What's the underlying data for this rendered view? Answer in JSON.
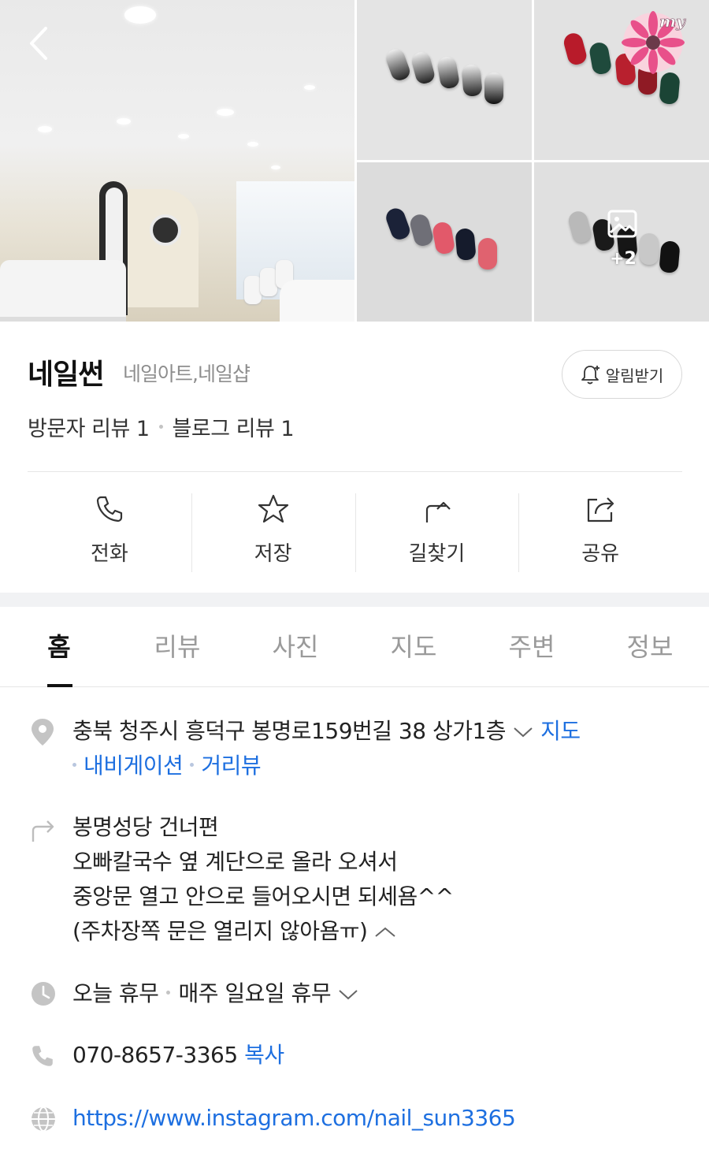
{
  "gallery": {
    "more_count": "+2",
    "sticker_text": "my"
  },
  "header": {
    "name": "네일썬",
    "category": "네일아트,네일샵",
    "alert_label": "알림받기",
    "visitor_reviews": "방문자 리뷰 1",
    "blog_reviews": "블로그 리뷰 1"
  },
  "actions": [
    {
      "label": "전화",
      "icon": "phone-icon"
    },
    {
      "label": "저장",
      "icon": "star-icon"
    },
    {
      "label": "길찾기",
      "icon": "directions-icon"
    },
    {
      "label": "공유",
      "icon": "share-icon"
    }
  ],
  "tabs": [
    "홈",
    "리뷰",
    "사진",
    "지도",
    "주변",
    "정보"
  ],
  "active_tab": "홈",
  "info": {
    "address": "충북 청주시 흥덕구 봉명로159번길 38 상가1층",
    "map_link": "지도",
    "navigation_link": "내비게이션",
    "streetview_link": "거리뷰",
    "directions": [
      "봉명성당 건너편",
      "오빠칼국수 옆 계단으로 올라 오셔서",
      "중앙문 열고 안으로 들어오시면 되세욤^^",
      "(주차장쪽 문은 열리지 않아욤ㅠ)"
    ],
    "hours_today": "오늘 휴무",
    "hours_detail": "매주 일요일 휴무",
    "phone": "070-8657-3365",
    "copy_label": "복사",
    "website": "https://www.instagram.com/nail_sun3365"
  },
  "colors": {
    "link": "#1d6fe0",
    "muted": "#8e8e8e",
    "divider": "#e6e6e6",
    "band": "#f1f2f4"
  }
}
